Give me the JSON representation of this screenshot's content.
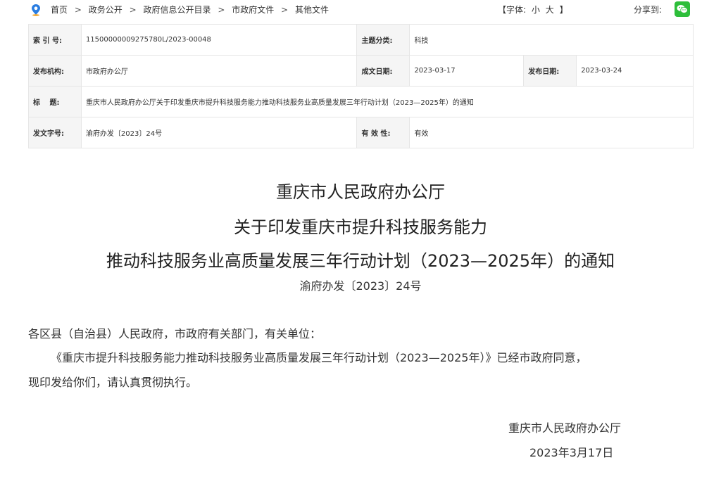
{
  "breadcrumb": {
    "items": [
      "首页",
      "政务公开",
      "政府信息公开目录",
      "市政府文件",
      "其他文件"
    ],
    "separator": ">"
  },
  "font_size": {
    "prefix": "【字体:",
    "small": "小",
    "large": "大",
    "suffix": "】"
  },
  "share": {
    "label": "分享到:"
  },
  "meta": {
    "index_label": "索 引 号:",
    "index_value": "11500000009275780L/2023-00048",
    "category_label": "主题分类:",
    "category_value": "科技",
    "publisher_label": "发布机构:",
    "publisher_value": "市政府办公厅",
    "created_label": "成文日期:",
    "created_value": "2023-03-17",
    "released_label": "发布日期:",
    "released_value": "2023-03-24",
    "title_label": "标　 题:",
    "title_value": "重庆市人民政府办公厅关于印发重庆市提升科技服务能力推动科技服务业高质量发展三年行动计划（2023—2025年）的通知",
    "docno_label": "发文字号:",
    "docno_value": "渝府办发〔2023〕24号",
    "validity_label": "有 效 性:",
    "validity_value": "有效"
  },
  "document": {
    "title_line1": "重庆市人民政府办公厅",
    "title_line2": "关于印发重庆市提升科技服务能力",
    "title_line3": "推动科技服务业高质量发展三年行动计划（2023—2025年）的通知",
    "doc_number": "渝府办发〔2023〕24号",
    "salutation": "各区县（自治县）人民政府，市政府有关部门，有关单位：",
    "body_line1": "《重庆市提升科技服务能力推动科技服务业高质量发展三年行动计划（2023—2025年）》已经市政府同意，",
    "body_line2": "现印发给你们，请认真贯彻执行。",
    "signature": "重庆市人民政府办公厅",
    "date": "2023年3月17日"
  },
  "colors": {
    "location_icon": "#2a7de1",
    "wechat_icon": "#2dbe3a",
    "label_bg": "#f5f5f5",
    "border": "#e6e6e6"
  }
}
